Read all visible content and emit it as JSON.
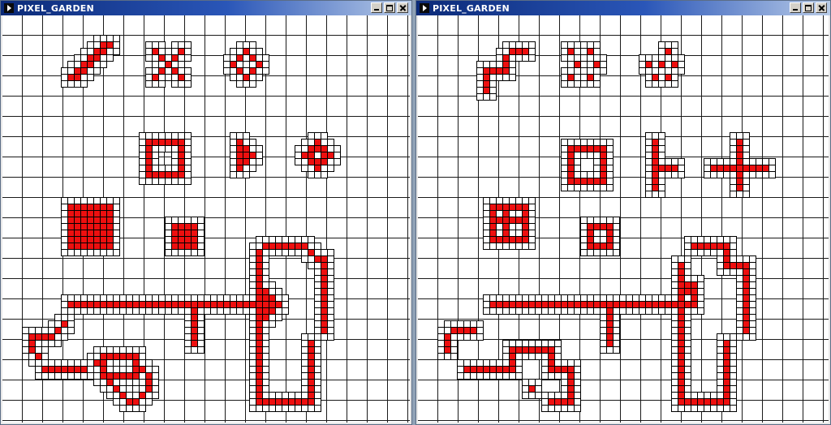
{
  "colors": {
    "live_cell": "#ee0f0f",
    "dead_cell": "#ffffff",
    "grid_line": "#1a1a1a",
    "title_gradient_start": "#0b2a78"
  },
  "windows": [
    {
      "title": "PIXEL_GARDEN",
      "icon": "play-icon",
      "controls": [
        "minimize-icon",
        "maximize-icon",
        "close-icon"
      ]
    },
    {
      "title": "PIXEL_GARDEN",
      "icon": "play-icon",
      "controls": [
        "minimize-icon",
        "maximize-icon",
        "close-icon"
      ]
    }
  ]
}
